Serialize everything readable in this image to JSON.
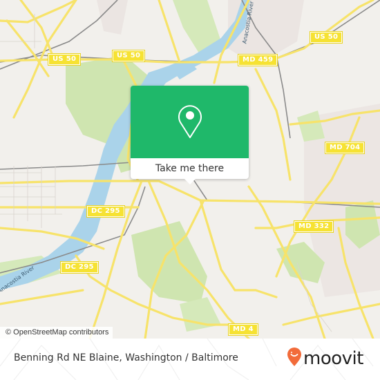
{
  "map": {
    "road_shields": [
      {
        "id": "us50-left",
        "label": "US 50"
      },
      {
        "id": "us50-mid",
        "label": "US 50"
      },
      {
        "id": "us50-right",
        "label": "US 50"
      },
      {
        "id": "md459",
        "label": "MD 459"
      },
      {
        "id": "md704",
        "label": "MD 704"
      },
      {
        "id": "dc295-upper",
        "label": "DC 295"
      },
      {
        "id": "md332",
        "label": "MD 332"
      },
      {
        "id": "dc295-lower",
        "label": "DC 295"
      },
      {
        "id": "md4",
        "label": "MD 4"
      }
    ],
    "river_labels": [
      {
        "id": "anacostia-upper",
        "label": "Anacostia River"
      },
      {
        "id": "anacostia-lower",
        "label": "Anacostia River"
      }
    ],
    "attribution": "© OpenStreetMap contributors",
    "colors": {
      "land": "#f2f0ec",
      "park": "#cfe5b0",
      "water": "#aad3ea",
      "road": "#f7e36a",
      "rail": "#8a8a8a"
    }
  },
  "popup": {
    "icon": "map-pin-icon",
    "button_label": "Take me there",
    "accent": "#1fb86a"
  },
  "footer": {
    "address": "Benning Rd NE Blaine, Washington / Baltimore",
    "brand": "moovit",
    "brand_icon": "moovit-pin-icon",
    "brand_color": "#f26b3a"
  }
}
